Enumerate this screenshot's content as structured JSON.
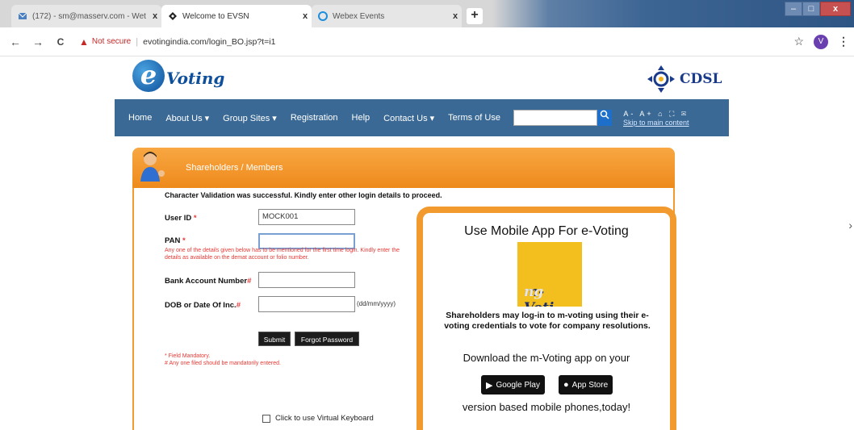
{
  "browser": {
    "tabs": [
      {
        "title": "(172) - sm@masserv.com - Wet",
        "close": "x"
      },
      {
        "title": "Welcome to EVSN",
        "close": "x"
      },
      {
        "title": "Webex Events",
        "close": "x"
      }
    ],
    "new_tab": "+",
    "window_controls": {
      "minimize": "–",
      "maximize": "□",
      "close": "x"
    },
    "nav": {
      "back": "←",
      "forward": "→",
      "reload": "C"
    },
    "address": {
      "security_label": "Not secure",
      "url": "evotingindia.com/login_BO.jsp?t=i1"
    },
    "avatar_letter": "V",
    "star": "☆",
    "menu": "⋮"
  },
  "logos": {
    "evoting_letter": "e",
    "evoting_text": "Voting",
    "cdsl_text": "CDSL"
  },
  "navbar": {
    "items": [
      "Home",
      "About Us ▾",
      "Group Sites ▾",
      "Registration",
      "Help",
      "Contact Us ▾",
      "Terms of Use"
    ],
    "search_button": "🔍",
    "skip_link": "Skip to main content"
  },
  "section": {
    "title": "Shareholders / Members"
  },
  "form": {
    "validation_message": "Character Validation was successful. Kindly enter other login details to proceed.",
    "user_id_label": "User ID",
    "user_id_value": "MOCK001",
    "pan_label": "PAN",
    "pan_note": "Any one of the details given below has to be mentioned for the first time login. Kindly enter the details as available on the demat account or folio number.",
    "bank_label": "Bank Account Number",
    "dob_label": "DOB or Date Of Inc.",
    "dob_hint": "(dd/mm/yyyy)",
    "required_marker": "*",
    "submit": "Submit",
    "forgot": "Forgot Password",
    "mandatory_note_1": "* Field Mandatory.",
    "mandatory_note_2": "# Any one filed should be mandatorily entered.",
    "virtual_keyboard": "Click to use Virtual Keyboard"
  },
  "mobile_panel": {
    "title": "Use Mobile App For e-Voting",
    "logo_text_main": "m-Voti",
    "logo_text_fade": "ng",
    "description": "Shareholders may log-in to m-voting using their e-voting credentials to vote for company resolutions.",
    "download_text": "Download the m-Voting app on your",
    "google_play": "Google Play",
    "app_store": "App Store",
    "version_text": "version based mobile phones,today!"
  },
  "colors": {
    "nav_blue": "#3a6995",
    "accent_orange": "#f29a2e",
    "required_red": "#e53935"
  }
}
